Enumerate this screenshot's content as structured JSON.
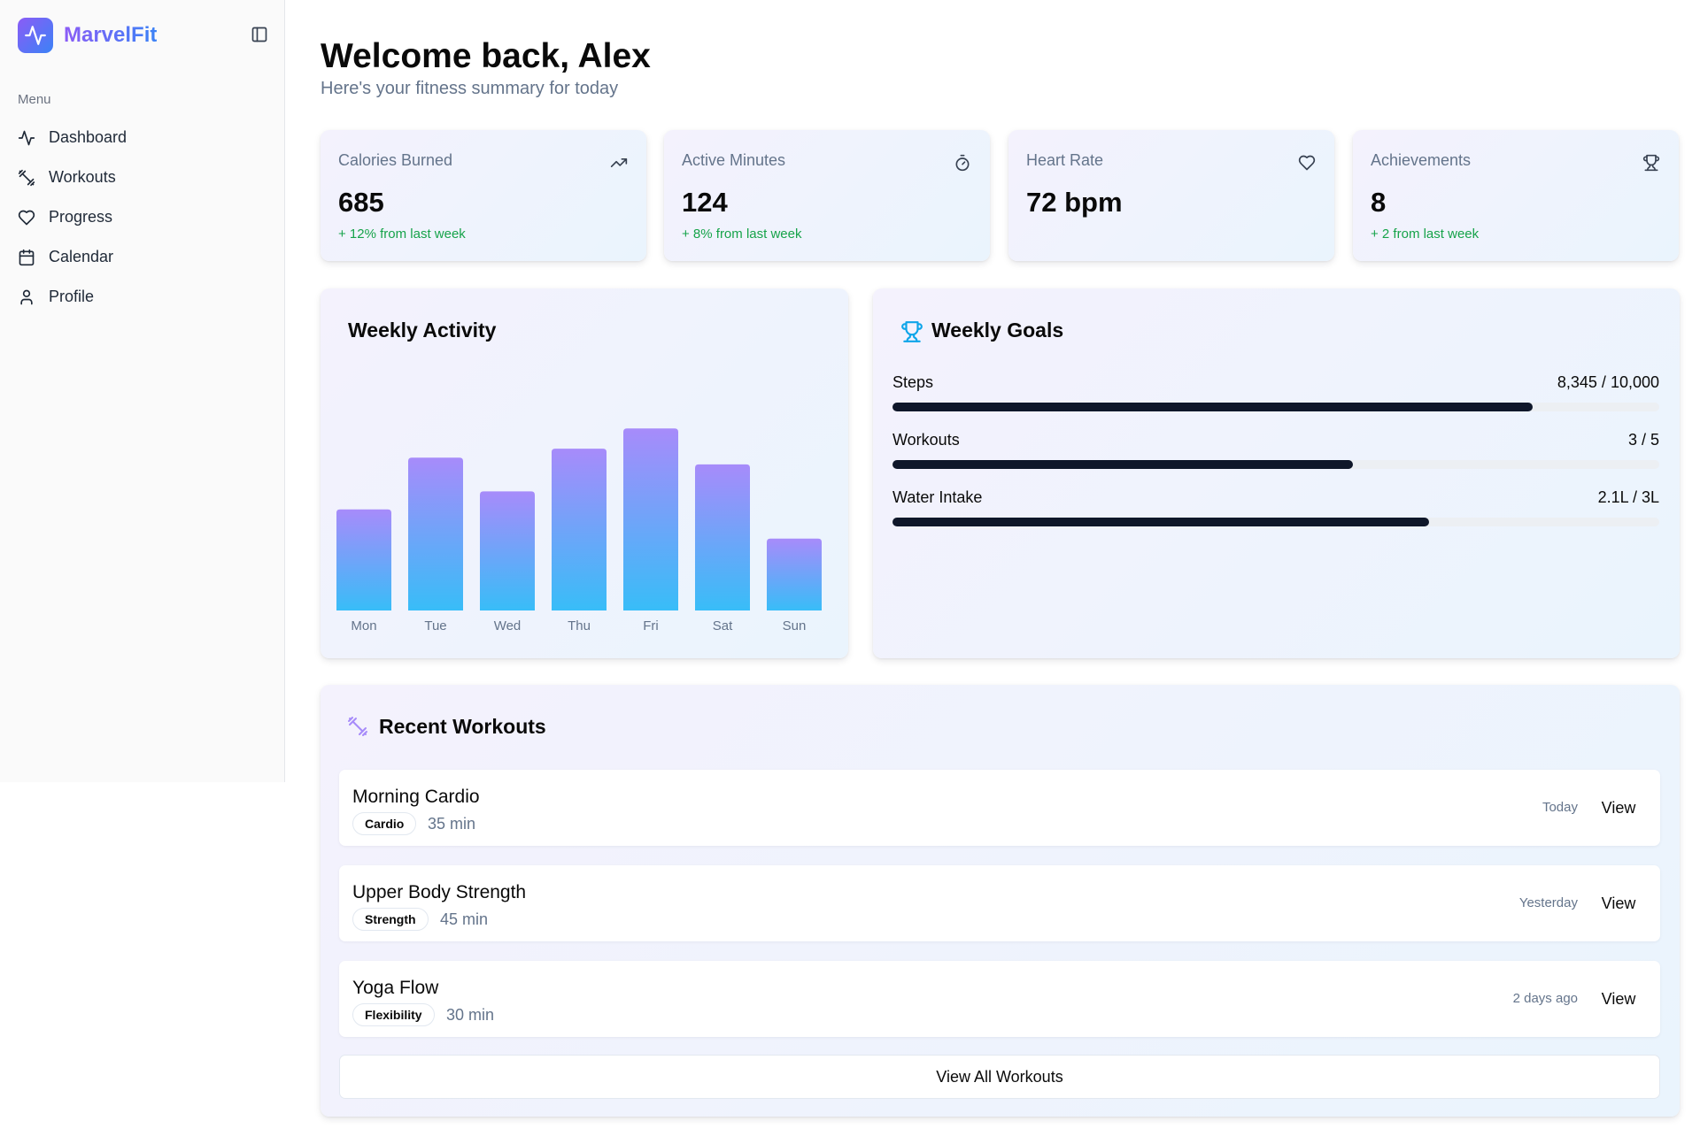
{
  "app": {
    "name": "MarvelFit",
    "logo_icon": "activity-pulse-icon",
    "brand_gradient": [
      "#8b5cf6",
      "#3b82f6"
    ]
  },
  "sidebar": {
    "menu_label": "Menu",
    "toggle_icon": "sidebar-panel-icon",
    "items": [
      {
        "label": "Dashboard",
        "icon": "activity-icon"
      },
      {
        "label": "Workouts",
        "icon": "dumbbell-icon"
      },
      {
        "label": "Progress",
        "icon": "heart-icon"
      },
      {
        "label": "Calendar",
        "icon": "calendar-icon"
      },
      {
        "label": "Profile",
        "icon": "user-icon"
      }
    ]
  },
  "header": {
    "title": "Welcome back, Alex",
    "subtitle": "Here's your fitness summary for today"
  },
  "stats": [
    {
      "title": "Calories Burned",
      "value": "685",
      "delta": "+ 12% from last week",
      "icon": "trending-up-icon"
    },
    {
      "title": "Active Minutes",
      "value": "124",
      "delta": "+ 8% from last week",
      "icon": "timer-icon"
    },
    {
      "title": "Heart Rate",
      "value": "72 bpm",
      "delta": "",
      "icon": "heart-icon"
    },
    {
      "title": "Achievements",
      "value": "8",
      "delta": "+ 2 from last week",
      "icon": "trophy-icon"
    }
  ],
  "weekly_activity": {
    "title": "Weekly Activity"
  },
  "chart_data": {
    "type": "bar",
    "title": "Weekly Activity",
    "categories": [
      "Mon",
      "Tue",
      "Wed",
      "Thu",
      "Fri",
      "Sat",
      "Sun"
    ],
    "values": [
      45,
      68,
      53,
      72,
      81,
      65,
      32
    ],
    "ylim": [
      0,
      100
    ],
    "grid": false,
    "bar_gradient": [
      "#a78bfa",
      "#38bdf8"
    ]
  },
  "goals": {
    "title": "Weekly Goals",
    "icon": "trophy-icon",
    "items": [
      {
        "label": "Steps",
        "value": "8,345 / 10,000",
        "progress": 0.8345
      },
      {
        "label": "Workouts",
        "value": "3 / 5",
        "progress": 0.6
      },
      {
        "label": "Water Intake",
        "value": "2.1L / 3L",
        "progress": 0.7
      }
    ]
  },
  "recent": {
    "title": "Recent Workouts",
    "icon": "dumbbell-icon",
    "items": [
      {
        "name": "Morning Cardio",
        "tag": "Cardio",
        "duration": "35 min",
        "when": "Today",
        "action": "View"
      },
      {
        "name": "Upper Body Strength",
        "tag": "Strength",
        "duration": "45 min",
        "when": "Yesterday",
        "action": "View"
      },
      {
        "name": "Yoga Flow",
        "tag": "Flexibility",
        "duration": "30 min",
        "when": "2 days ago",
        "action": "View"
      }
    ],
    "view_all": "View All Workouts"
  }
}
